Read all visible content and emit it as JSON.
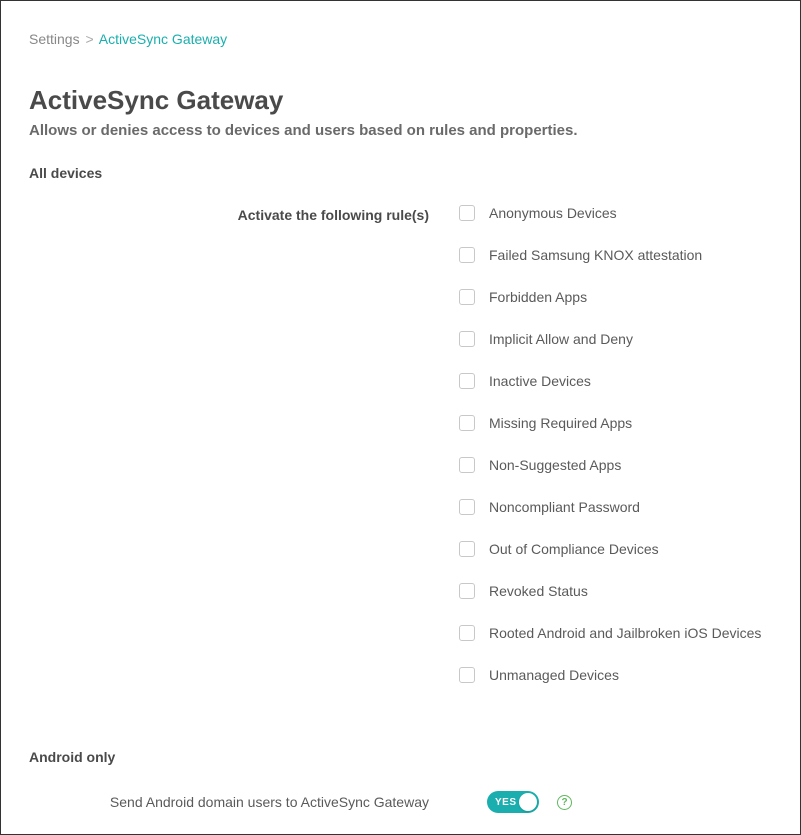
{
  "breadcrumb": {
    "root": "Settings",
    "separator": ">",
    "current": "ActiveSync Gateway"
  },
  "header": {
    "title": "ActiveSync Gateway",
    "subtitle": "Allows or denies access to devices and users based on rules and properties."
  },
  "sections": {
    "all_devices": {
      "heading": "All devices",
      "label": "Activate the following rule(s)"
    },
    "android_only": {
      "heading": "Android only",
      "label": "Send Android domain users to ActiveSync Gateway"
    }
  },
  "rules": [
    {
      "label": "Anonymous Devices"
    },
    {
      "label": "Failed Samsung KNOX attestation"
    },
    {
      "label": "Forbidden Apps"
    },
    {
      "label": "Implicit Allow and Deny"
    },
    {
      "label": "Inactive Devices"
    },
    {
      "label": "Missing Required Apps"
    },
    {
      "label": "Non-Suggested Apps"
    },
    {
      "label": "Noncompliant Password"
    },
    {
      "label": "Out of Compliance Devices"
    },
    {
      "label": "Revoked Status"
    },
    {
      "label": "Rooted Android and Jailbroken iOS Devices"
    },
    {
      "label": "Unmanaged Devices"
    }
  ],
  "toggle": {
    "state_text": "YES"
  },
  "help_glyph": "?"
}
